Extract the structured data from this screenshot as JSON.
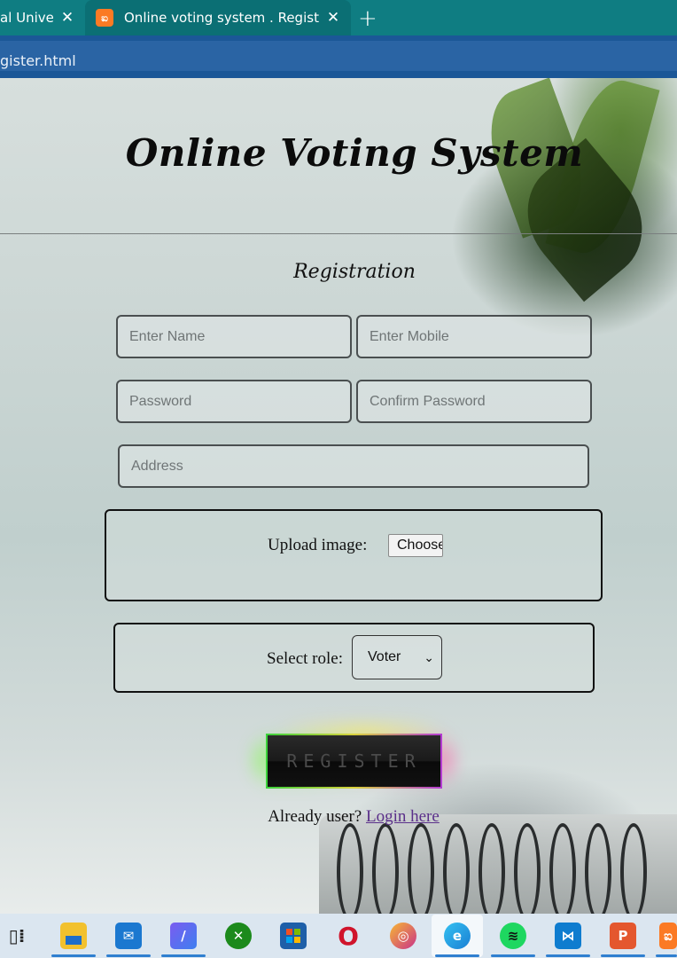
{
  "browser": {
    "tabs": [
      {
        "title": "al Univer",
        "active": false
      },
      {
        "title": "Online voting system . Registratio",
        "active": true
      }
    ],
    "new_tab_glyph": "+",
    "close_glyph": "✕",
    "url": "gister.html"
  },
  "page": {
    "site_title": "Online Voting System",
    "subtitle": "Registration",
    "fields": {
      "name_placeholder": "Enter Name",
      "mobile_placeholder": "Enter Mobile",
      "password_placeholder": "Password",
      "confirm_password_placeholder": "Confirm Password",
      "address_placeholder": "Address"
    },
    "upload": {
      "label": "Upload image:",
      "button": "Choose"
    },
    "role": {
      "label": "Select role:",
      "selected": "Voter"
    },
    "register_button": "REGISTER",
    "login_prompt": "Already user?",
    "login_link": "Login here"
  },
  "taskbar": {
    "icons": [
      "task-view-icon",
      "file-explorer-icon",
      "mail-icon",
      "vs-icon",
      "xbox-icon",
      "store-icon",
      "opera-icon",
      "vpn-icon",
      "edge-icon",
      "spotify-icon",
      "vscode-icon",
      "powerpoint-icon",
      "xampp-icon"
    ]
  },
  "colors": {
    "tab_bar": "#0f7d82",
    "address_bar": "#1b5797",
    "link": "#5a2f8a",
    "taskbar": "#dbe6f0"
  }
}
